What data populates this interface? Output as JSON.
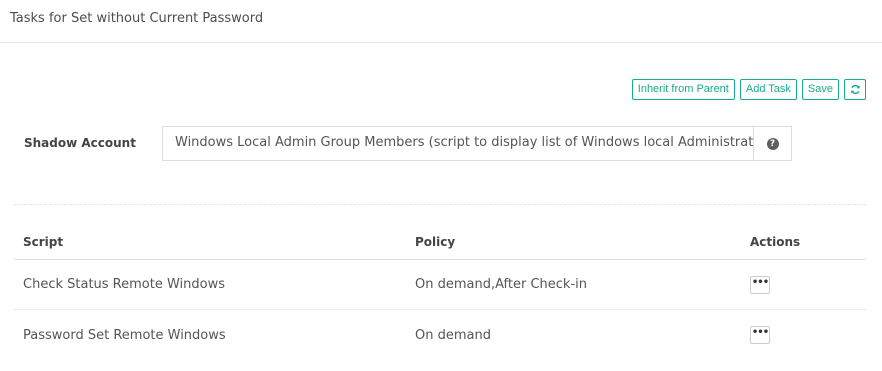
{
  "panel": {
    "title": "Tasks for Set without Current Password"
  },
  "toolbar": {
    "inherit_label": "Inherit from Parent",
    "add_task_label": "Add Task",
    "save_label": "Save",
    "refresh_icon": "refresh-icon"
  },
  "shadow_account": {
    "label": "Shadow Account",
    "value": "Windows Local Admin Group Members (script to display list of Windows local Administrators)",
    "help_icon": "question-circle-icon"
  },
  "table": {
    "headers": {
      "script": "Script",
      "policy": "Policy",
      "actions": "Actions"
    },
    "rows": [
      {
        "script": "Check Status Remote Windows",
        "policy": "On demand,After Check-in",
        "action_icon": "more-icon"
      },
      {
        "script": "Password Set Remote Windows",
        "policy": "On demand",
        "action_icon": "more-icon"
      }
    ]
  },
  "colors": {
    "accent": "#1aab8a",
    "border": "#dddddd",
    "text": "#555555"
  }
}
